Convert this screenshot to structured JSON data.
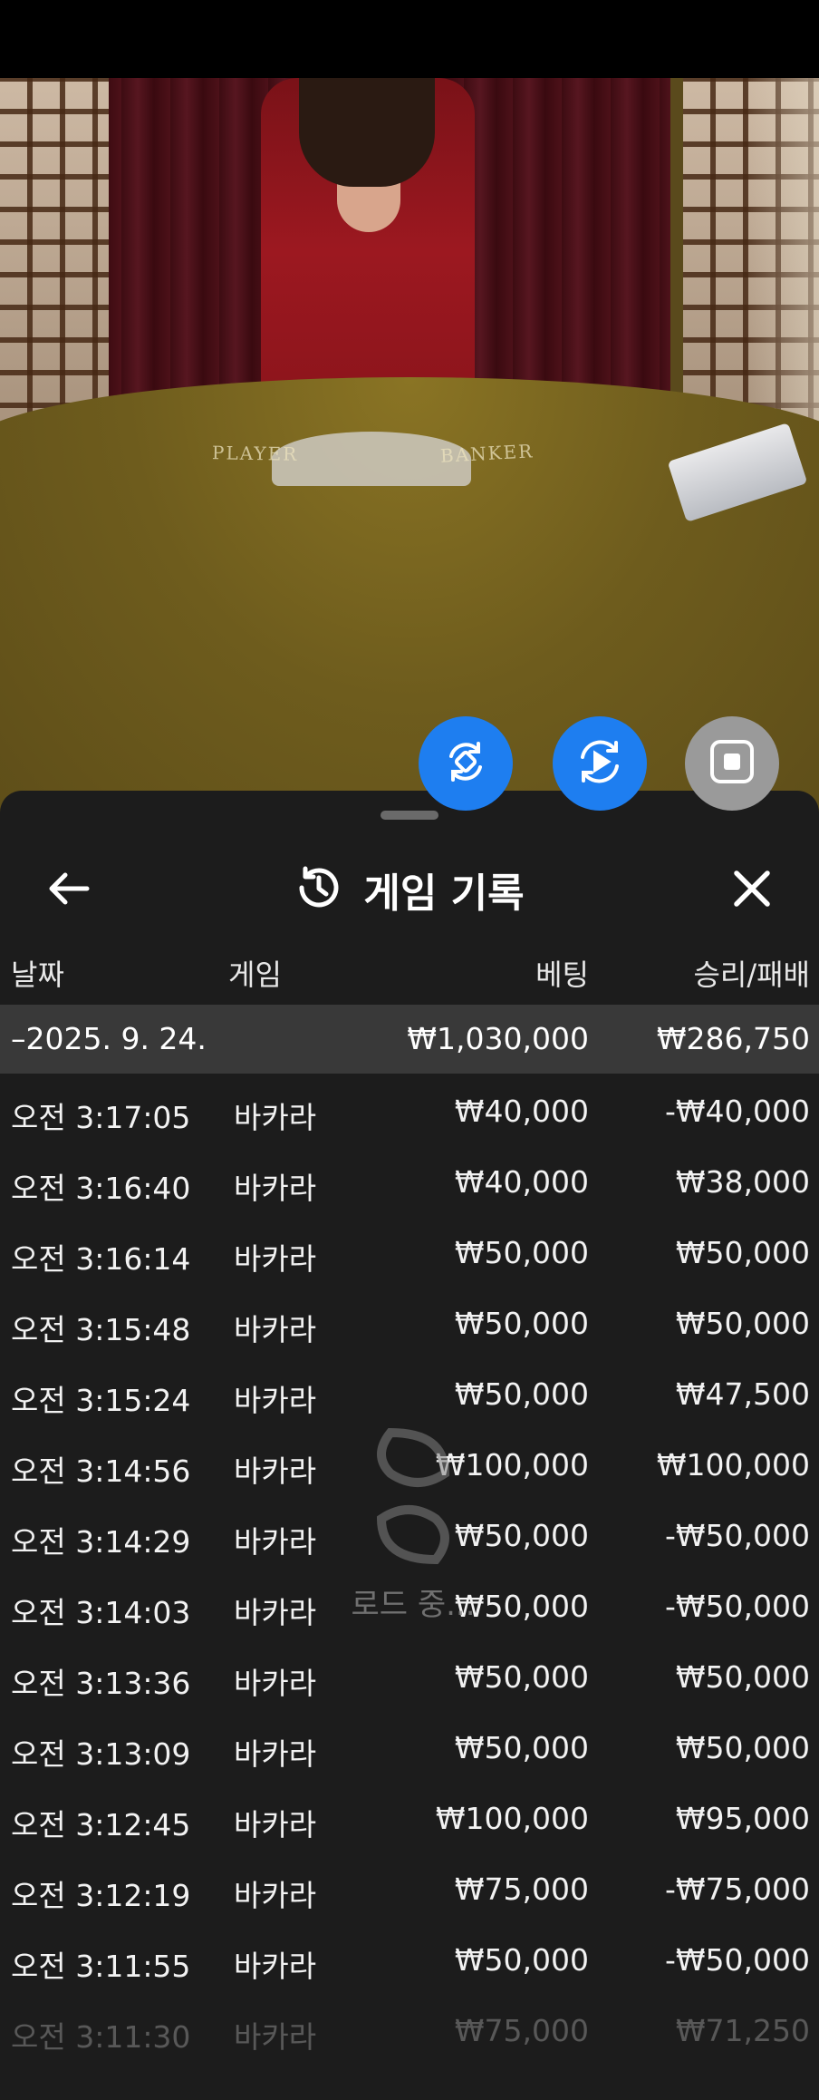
{
  "video": {
    "table_labels": {
      "player": "PLAYER",
      "banker": "BANKER"
    }
  },
  "fabs": [
    {
      "name": "swap-view",
      "color": "#1e7ef0",
      "icon": "refresh-diamond-icon"
    },
    {
      "name": "replay",
      "color": "#1e7ef0",
      "icon": "replay-play-icon"
    },
    {
      "name": "stop",
      "color": "#9a9a9a",
      "icon": "stop-square-icon"
    }
  ],
  "sheet": {
    "title": "게임 기록",
    "back_icon": "arrow-left-icon",
    "title_icon": "history-clock-icon",
    "close_icon": "close-icon",
    "columns": {
      "date": "날짜",
      "game": "게임",
      "bet": "베팅",
      "winloss": "승리/패배"
    },
    "summary": {
      "date": "–2025. 9. 24.",
      "bet": "₩1,030,000",
      "winloss": "₩286,750"
    },
    "rows": [
      {
        "time": "오전 3:17:05",
        "game": "바카라",
        "bet": "₩40,000",
        "winloss": "-₩40,000"
      },
      {
        "time": "오전 3:16:40",
        "game": "바카라",
        "bet": "₩40,000",
        "winloss": "₩38,000"
      },
      {
        "time": "오전 3:16:14",
        "game": "바카라",
        "bet": "₩50,000",
        "winloss": "₩50,000"
      },
      {
        "time": "오전 3:15:48",
        "game": "바카라",
        "bet": "₩50,000",
        "winloss": "₩50,000"
      },
      {
        "time": "오전 3:15:24",
        "game": "바카라",
        "bet": "₩50,000",
        "winloss": "₩47,500"
      },
      {
        "time": "오전 3:14:56",
        "game": "바카라",
        "bet": "₩100,000",
        "winloss": "₩100,000"
      },
      {
        "time": "오전 3:14:29",
        "game": "바카라",
        "bet": "₩50,000",
        "winloss": "-₩50,000"
      },
      {
        "time": "오전 3:14:03",
        "game": "바카라",
        "bet": "₩50,000",
        "winloss": "-₩50,000"
      },
      {
        "time": "오전 3:13:36",
        "game": "바카라",
        "bet": "₩50,000",
        "winloss": "₩50,000"
      },
      {
        "time": "오전 3:13:09",
        "game": "바카라",
        "bet": "₩50,000",
        "winloss": "₩50,000"
      },
      {
        "time": "오전 3:12:45",
        "game": "바카라",
        "bet": "₩100,000",
        "winloss": "₩95,000"
      },
      {
        "time": "오전 3:12:19",
        "game": "바카라",
        "bet": "₩75,000",
        "winloss": "-₩75,000"
      },
      {
        "time": "오전 3:11:55",
        "game": "바카라",
        "bet": "₩50,000",
        "winloss": "-₩50,000"
      },
      {
        "time": "오전 3:11:30",
        "game": "바카라",
        "bet": "₩75,000",
        "winloss": "₩71,250"
      }
    ],
    "loading_text": "로드 중..."
  }
}
